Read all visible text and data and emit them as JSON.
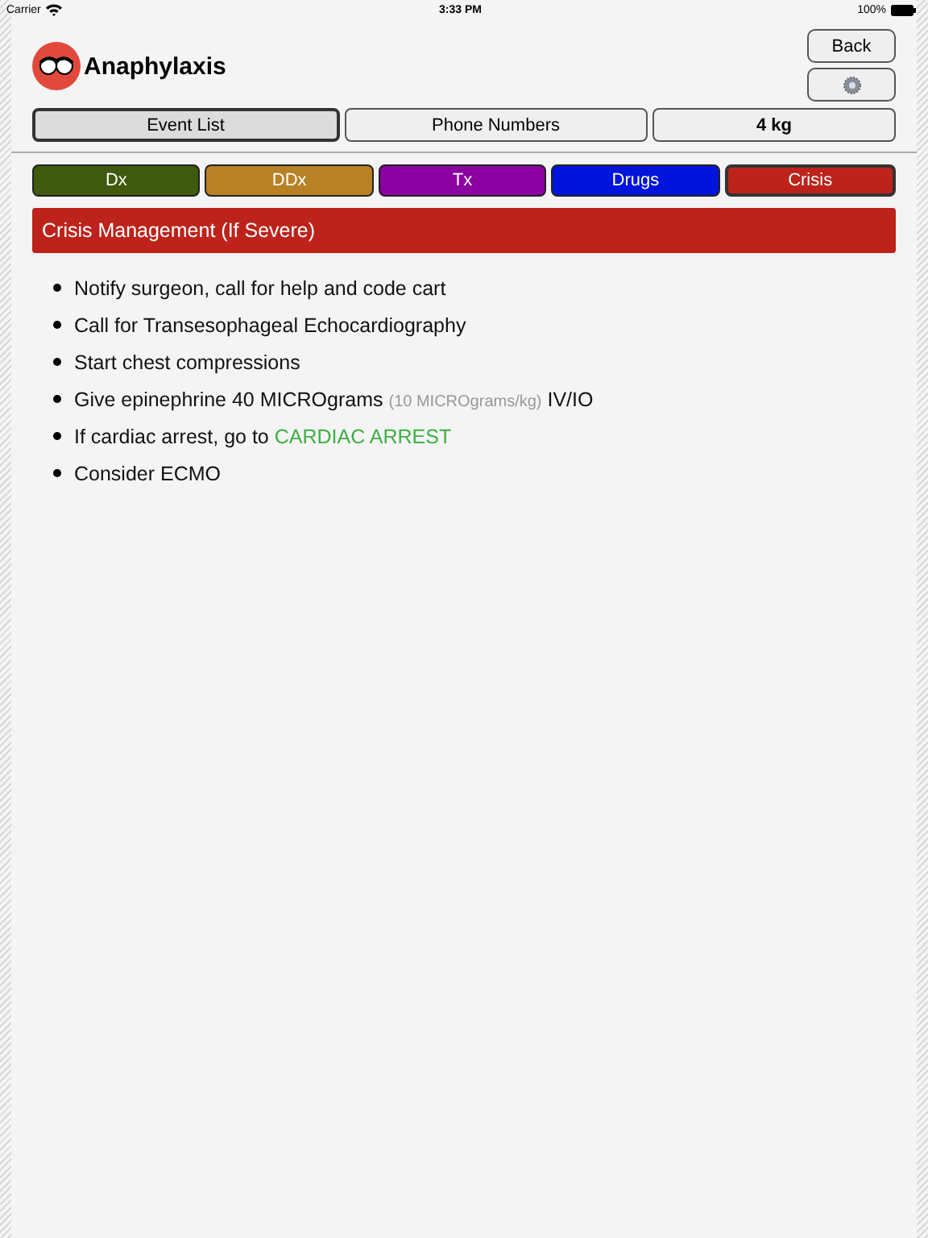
{
  "status_bar": {
    "carrier": "Carrier",
    "time": "3:33 PM",
    "battery": "100%"
  },
  "header": {
    "title": "Anaphylaxis",
    "back_button": "Back"
  },
  "top_tabs": [
    {
      "label": "Event List",
      "selected": true,
      "kind": "plain"
    },
    {
      "label": "Phone Numbers",
      "selected": false,
      "kind": "plain"
    },
    {
      "label": "4 kg",
      "selected": false,
      "kind": "weight"
    }
  ],
  "section_tabs": [
    {
      "label": "Dx",
      "selected": false,
      "color": "#3f5a0c"
    },
    {
      "label": "DDx",
      "selected": false,
      "color": "#b88125"
    },
    {
      "label": "Tx",
      "selected": false,
      "color": "#8b00a0"
    },
    {
      "label": "Drugs",
      "selected": false,
      "color": "#0014dc"
    },
    {
      "label": "Crisis",
      "selected": true,
      "color": "#bd231b"
    }
  ],
  "section_heading": "Crisis Management (If Severe)",
  "items": [
    {
      "parts": [
        {
          "kind": "plain",
          "text": "Notify surgeon, call for help and code cart"
        }
      ]
    },
    {
      "parts": [
        {
          "kind": "plain",
          "text": "Call for Transesophageal Echocardiography"
        }
      ]
    },
    {
      "parts": [
        {
          "kind": "plain",
          "text": "Start chest compressions"
        }
      ]
    },
    {
      "parts": [
        {
          "kind": "plain",
          "text": "Give epinephrine 40 MICROgrams "
        },
        {
          "kind": "note",
          "text": "(10 MICROgrams/kg)"
        },
        {
          "kind": "plain",
          "text": " IV/IO"
        }
      ]
    },
    {
      "parts": [
        {
          "kind": "plain",
          "text": "If cardiac arrest, go to "
        },
        {
          "kind": "link",
          "text": "CARDIAC ARREST"
        }
      ]
    },
    {
      "parts": [
        {
          "kind": "plain",
          "text": "Consider ECMO"
        }
      ]
    }
  ]
}
